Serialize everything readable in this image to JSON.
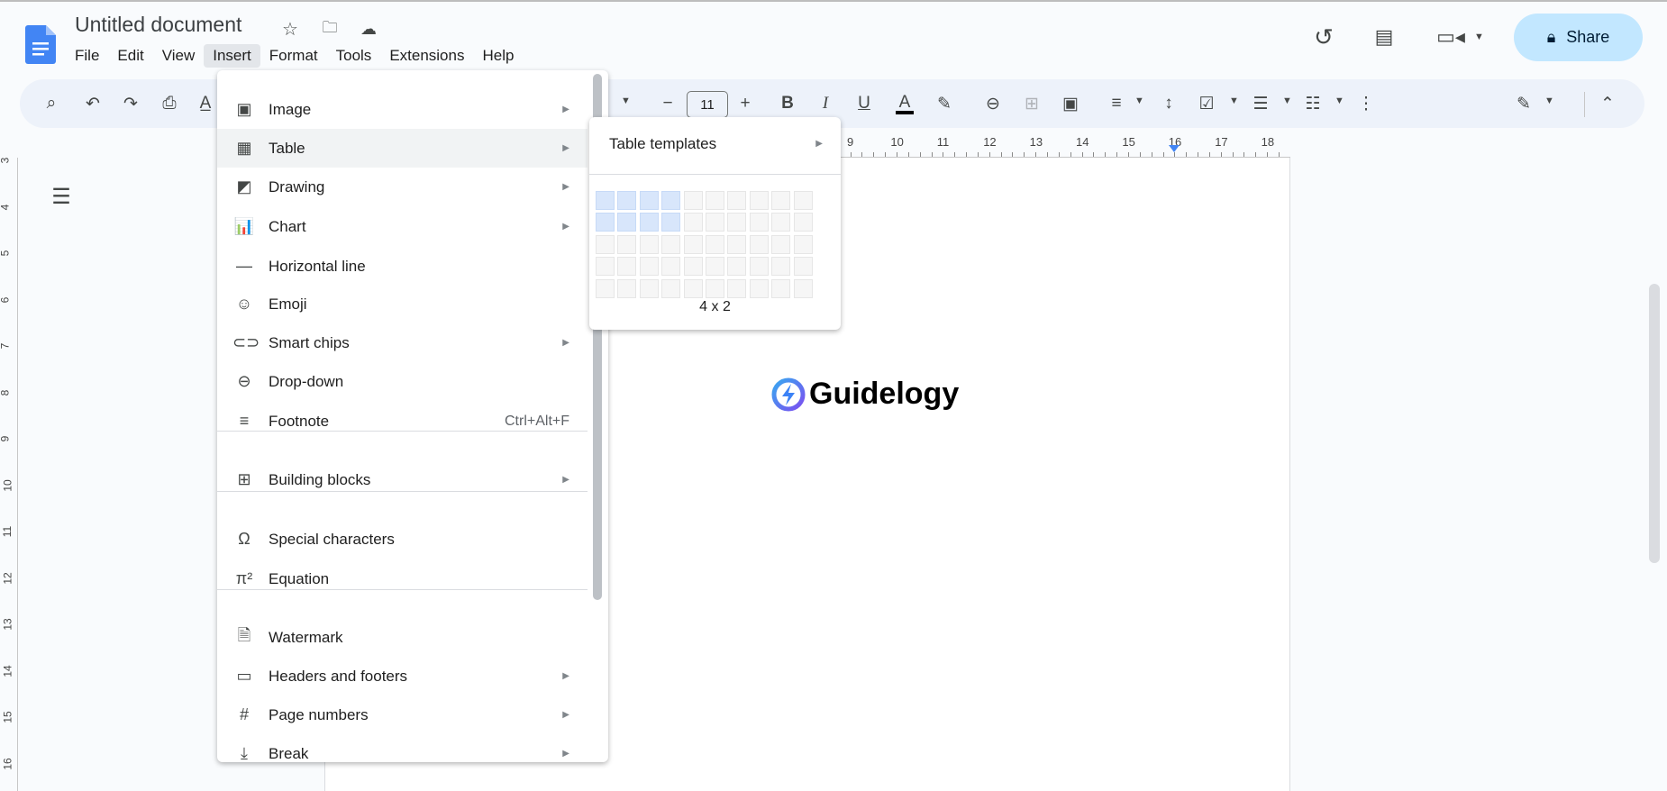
{
  "title": "Untitled document",
  "menubar": [
    "File",
    "Edit",
    "View",
    "Insert",
    "Format",
    "Tools",
    "Extensions",
    "Help"
  ],
  "share_label": "Share",
  "font_size": "11",
  "ruler_numbers": [
    "9",
    "10",
    "11",
    "12",
    "13",
    "14",
    "15",
    "16",
    "17",
    "18"
  ],
  "vruler_numbers": [
    "3",
    "4",
    "5",
    "6",
    "7",
    "8",
    "9",
    "10",
    "11",
    "12",
    "13",
    "14",
    "15",
    "16"
  ],
  "insert_menu": [
    {
      "label": "Image",
      "icon": "image-icon",
      "glyph": "▣",
      "submenu": true
    },
    {
      "label": "Table",
      "icon": "table-icon",
      "glyph": "▦",
      "submenu": true
    },
    {
      "label": "Drawing",
      "icon": "drawing-icon",
      "glyph": "◩",
      "submenu": true
    },
    {
      "label": "Chart",
      "icon": "chart-icon",
      "glyph": "📊",
      "submenu": true
    },
    {
      "label": "Horizontal line",
      "icon": "horizontal-line-icon",
      "glyph": "—"
    },
    {
      "label": "Emoji",
      "icon": "emoji-icon",
      "glyph": "☺"
    },
    {
      "label": "Smart chips",
      "icon": "smart-chips-icon",
      "glyph": "⊂⊃",
      "submenu": true
    },
    {
      "label": "Drop-down",
      "icon": "dropdown-icon",
      "glyph": "⊖"
    },
    {
      "label": "Footnote",
      "icon": "footnote-icon",
      "glyph": "≡",
      "shortcut": "Ctrl+Alt+F"
    },
    {
      "label": "Building blocks",
      "icon": "building-blocks-icon",
      "glyph": "⊞",
      "submenu": true
    },
    {
      "label": "Special characters",
      "icon": "omega-icon",
      "glyph": "Ω"
    },
    {
      "label": "Equation",
      "icon": "pi-icon",
      "glyph": "π²"
    },
    {
      "label": "Watermark",
      "icon": "watermark-icon",
      "glyph": "🗎"
    },
    {
      "label": "Headers and footers",
      "icon": "headers-footers-icon",
      "glyph": "▭",
      "submenu": true
    },
    {
      "label": "Page numbers",
      "icon": "hash-icon",
      "glyph": "#",
      "submenu": true
    },
    {
      "label": "Break",
      "icon": "break-icon",
      "glyph": "⤓",
      "submenu": true
    }
  ],
  "table_submenu": {
    "templates_label": "Table templates",
    "grid_cols": 10,
    "grid_rows": 5,
    "selected_cols": 4,
    "selected_rows": 2,
    "size_label": "4 x 2"
  },
  "logo_text": "Guidelogy",
  "colors": {
    "accent": "#1a73e8",
    "share_bg": "#c2e7ff",
    "grid_selected": "#d8e6fb"
  }
}
